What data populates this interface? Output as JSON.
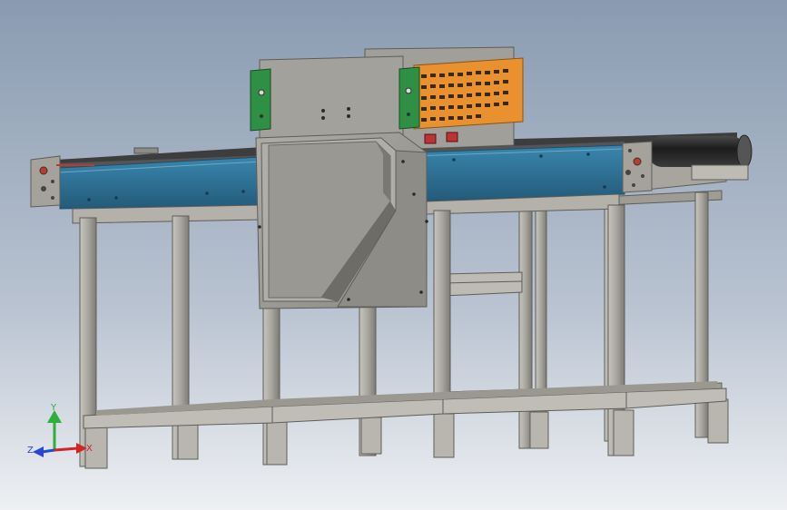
{
  "colors": {
    "bg_top": "#8a9bb1",
    "bg_bottom": "#e3e7ed",
    "frame": "#a9a7a0",
    "frame_dark": "#6e6c66",
    "belt_blue": "#2f6f93",
    "belt_dark": "#1f4f6b",
    "hood": "#9c9a95",
    "hood_dark": "#6a6964",
    "bracket_green": "#2f8f45",
    "orange": "#e8912e",
    "roller": "#2b2b2b",
    "axis_x": "#d32424",
    "axis_y": "#2fae3c",
    "axis_z": "#2a44d6"
  },
  "triad": {
    "x_label": "X",
    "y_label": "Y",
    "z_label": "Z"
  },
  "icons": {
    "triad": "xyz-axis-triad-icon"
  }
}
